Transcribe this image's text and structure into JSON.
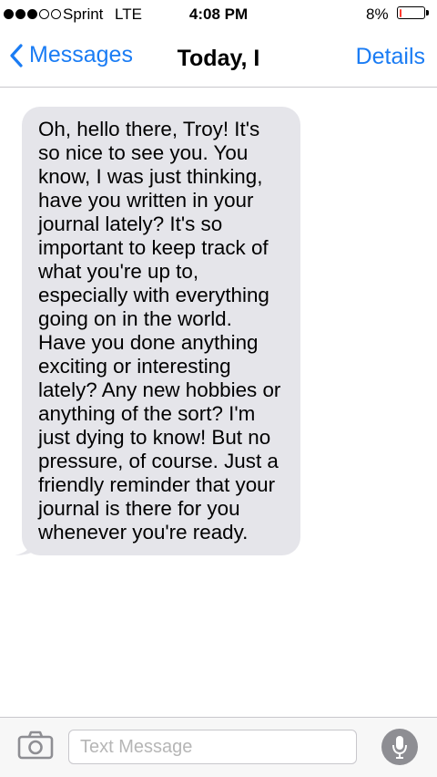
{
  "status_bar": {
    "signal_filled": 3,
    "signal_total": 5,
    "carrier": "Sprint",
    "network": "LTE",
    "time": "4:08 PM",
    "battery_percent": "8%",
    "battery_level": 0.08,
    "battery_color": "#ff3b30"
  },
  "nav": {
    "back_label": "Messages",
    "title": "Today, I",
    "details_label": "Details"
  },
  "messages": [
    {
      "direction": "incoming",
      "text": "Oh, hello there, Troy! It's so nice to see you. You know, I was just thinking, have you written in your journal lately? It's so important to keep track of what you're up to, especially with everything going on in the world. Have you done anything exciting or interesting lately? Any new hobbies or anything of the sort? I'm just dying to know! But no pressure, of course. Just a friendly reminder that your journal is there for you whenever you're ready."
    }
  ],
  "input_bar": {
    "placeholder": "Text Message",
    "value": ""
  },
  "icons": {
    "back": "chevron-left-icon",
    "camera": "camera-icon",
    "mic": "microphone-icon"
  },
  "colors": {
    "accent": "#1a7cf4",
    "incoming_bubble": "#e5e5ea",
    "mic_button": "#8e8e93"
  }
}
